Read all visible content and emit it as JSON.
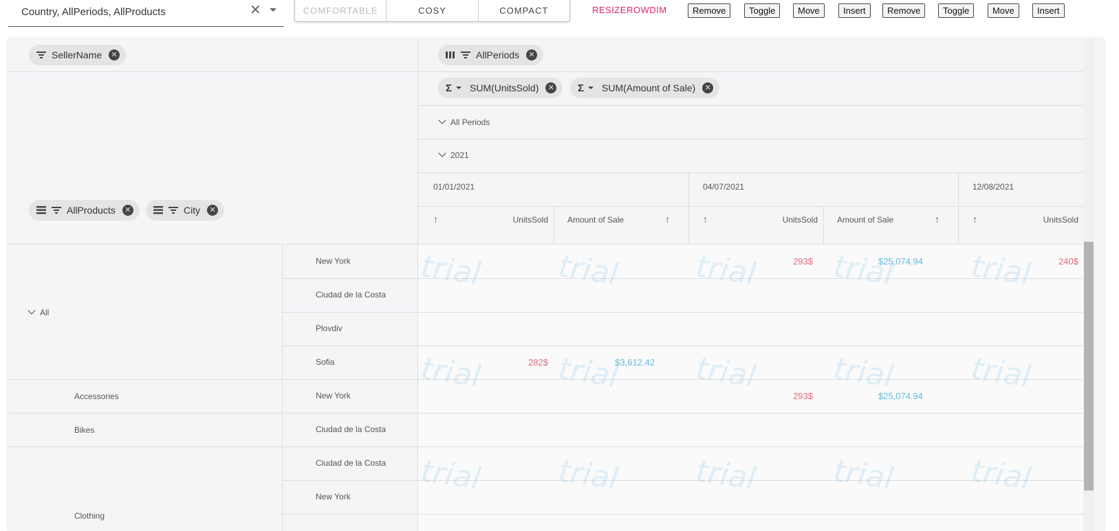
{
  "toolbar": {
    "combo_value": "Country, AllPeriods, AllProducts",
    "density": [
      "COMFORTABLE",
      "COSY",
      "COMPACT"
    ],
    "resize_label": "RESIZEROWDIM",
    "buttons": [
      "Remove",
      "Toggle",
      "Move",
      "Insert",
      "Remove",
      "Toggle",
      "Move",
      "Insert"
    ]
  },
  "pivot": {
    "filter_chip": "SellerName",
    "column_chip": "AllPeriods",
    "value_chips": [
      "SUM(UnitsSold)",
      "SUM(Amount of Sale)"
    ],
    "row_chips": [
      "AllProducts",
      "City"
    ],
    "all_periods": "All Periods",
    "year": "2021",
    "dates": [
      "01/01/2021",
      "04/07/2021",
      "12/08/2021"
    ],
    "measures": [
      "UnitsSold",
      "Amount of Sale"
    ],
    "watermark": "trial"
  },
  "rows": [
    {
      "group": "All",
      "city": "New York",
      "d1_units": "",
      "d1_amt": "",
      "d2_units": "293$",
      "d2_amt": "$25,074.94",
      "d3_units": "240$"
    },
    {
      "group": "",
      "city": "Ciudad de la Costa",
      "d1_units": "",
      "d1_amt": "",
      "d2_units": "",
      "d2_amt": "",
      "d3_units": ""
    },
    {
      "group": "",
      "city": "Plovdiv",
      "d1_units": "",
      "d1_amt": "",
      "d2_units": "",
      "d2_amt": "",
      "d3_units": ""
    },
    {
      "group": "",
      "city": "Sofia",
      "d1_units": "282$",
      "d1_amt": "$3,612.42",
      "d2_units": "",
      "d2_amt": "",
      "d3_units": ""
    },
    {
      "group": "Accessories",
      "city": "New York",
      "d1_units": "",
      "d1_amt": "",
      "d2_units": "293$",
      "d2_amt": "$25,074.94",
      "d3_units": ""
    },
    {
      "group": "Bikes",
      "city": "Ciudad de la Costa",
      "d1_units": "",
      "d1_amt": "",
      "d2_units": "",
      "d2_amt": "",
      "d3_units": ""
    },
    {
      "group": "",
      "city": "Ciudad de la Costa",
      "d1_units": "",
      "d1_amt": "",
      "d2_units": "",
      "d2_amt": "",
      "d3_units": ""
    },
    {
      "group": "Clothing",
      "city": "New York",
      "d1_units": "",
      "d1_amt": "",
      "d2_units": "",
      "d2_amt": "",
      "d3_units": ""
    }
  ]
}
